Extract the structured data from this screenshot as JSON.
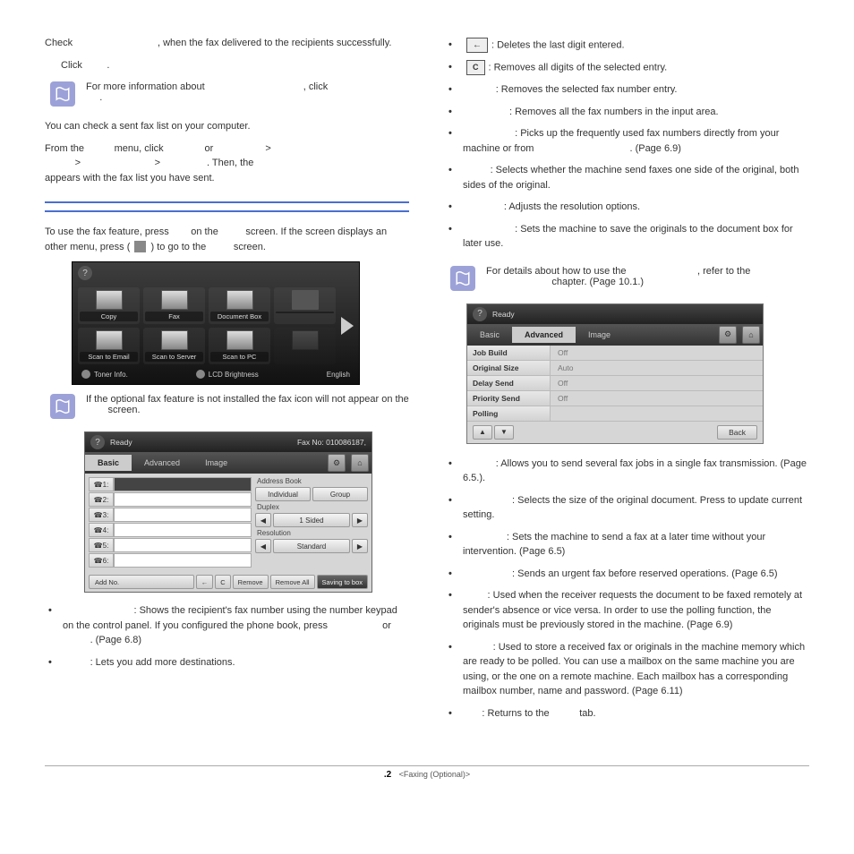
{
  "left": {
    "p1a": "Check ",
    "p1b": ", when the fax delivered to the recipients successfully.",
    "p2": "Click ",
    "note1": "For more information about ",
    "note1b": ", click",
    "p3": "You can check a sent fax list on your computer.",
    "p4a": "From the ",
    "p4b": " menu, click ",
    "p4c": " or ",
    "p4d": " > ",
    "p4e": " > ",
    "p4f": ". Then, the ",
    "p4g": "appears with the fax list you have sent.",
    "p5a": "To use the fax feature, press ",
    "p5b": " on the ",
    "p5c": " screen. If the screen displays an other menu, press ( ",
    "p5d": " ) to go to the ",
    "p5e": " screen.",
    "note2": "If the optional fax feature is not installed the fax icon will not appear on the ",
    "note2b": " screen.",
    "li1a": ": Shows the recipient's fax number using the number keypad on the control panel. If you configured the phone book, press ",
    "li1b": " or ",
    "li1c": ". (Page 6.8)",
    "li2": ": Lets you add more destinations."
  },
  "shot1": {
    "tiles": [
      "Copy",
      "Fax",
      "Document Box",
      "",
      "Scan to Email",
      "Scan to Server",
      "Scan to PC",
      ""
    ],
    "bottom": {
      "left": "Toner Info.",
      "mid": "LCD Brightness",
      "right": "English"
    }
  },
  "shot2": {
    "ready": "Ready",
    "faxno": "Fax No: 010086187,",
    "tabs": [
      "Basic",
      "Advanced",
      "Image"
    ],
    "labels": [
      "1:",
      "2:",
      "3:",
      "4:",
      "5:",
      "6:"
    ],
    "book": "Address Book",
    "ind": "Individual",
    "grp": "Group",
    "dup": "Duplex",
    "sided": "1 Sided",
    "res": "Resolution",
    "std": "Standard",
    "footer": {
      "add": "Add No.",
      "back": "←",
      "c": "C",
      "rem": "Remove",
      "remall": "Remove All",
      "save": "Saving to box"
    }
  },
  "right": {
    "li1": ": Deletes the last digit entered.",
    "li2": ": Removes all digits of the selected entry.",
    "li3": ": Removes the selected fax number entry.",
    "li4": ": Removes all the fax numbers in the input area.",
    "li5": ": Picks up the frequently used fax numbers directly from your machine or from ",
    "li5b": ". (Page 6.9)",
    "li6": ": Selects whether the machine send faxes one side of the original, both sides of the original.",
    "li7": ": Adjusts the resolution options.",
    "li8": ": Sets the machine to save the originals to the document box for later use.",
    "note": "For details about how to use the ",
    "noteb": ", refer to the ",
    "notec": " chapter. (Page 10.1.)",
    "li9": ": Allows you to send several fax jobs in a single fax transmission. (Page 6.5.).",
    "li10": ": Selects the size of the original document. Press to update current setting.",
    "li11": ": Sets the machine to send a fax at a later time without your intervention. (Page 6.5)",
    "li12": ": Sends an urgent fax before reserved operations. (Page 6.5)",
    "li13": ": Used when the receiver requests the document to be faxed remotely at sender's absence or vice versa. In order to use the polling function, the originals must be previously stored in the machine. (Page 6.9)",
    "li14": ": Used to store a received fax or originals in the machine memory which are ready to be polled. You can use a mailbox on the same machine you are using, or the one on a remote machine. Each mailbox has a corresponding mailbox number, name and password. (Page 6.11)",
    "li15a": ": Returns to the ",
    "li15b": " tab."
  },
  "shot3": {
    "ready": "Ready",
    "tabs": [
      "Basic",
      "Advanced",
      "Image"
    ],
    "rows": [
      {
        "k": "Job Build",
        "v": "Off"
      },
      {
        "k": "Original Size",
        "v": "Auto"
      },
      {
        "k": "Delay Send",
        "v": "Off"
      },
      {
        "k": "Priority Send",
        "v": "Off"
      },
      {
        "k": "Polling",
        "v": ""
      }
    ],
    "back": "Back"
  },
  "footer": {
    "num": ".2",
    "label": "<Faxing (Optional)>"
  }
}
